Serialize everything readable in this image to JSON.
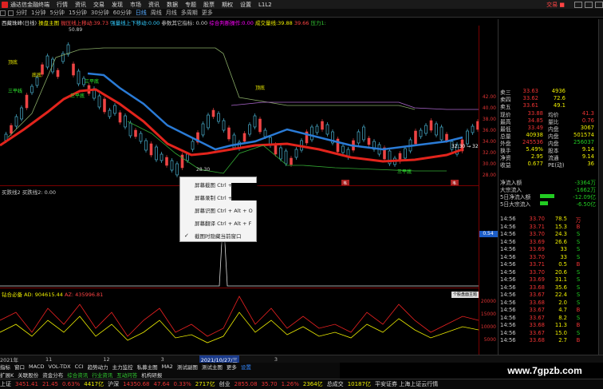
{
  "menubar": {
    "app_title": "通达信金融终端",
    "items": [
      "行情",
      "资讯",
      "交易",
      "发现",
      "市场",
      "资讯",
      "数据",
      "专题",
      "股票",
      "期权",
      "设置"
    ],
    "user": "L1L2",
    "trade_label": "交易 ■"
  },
  "toolbar": {
    "items": [
      "分时",
      "1分钟",
      "5分钟",
      "15分钟",
      "30分钟",
      "60分钟",
      "日线",
      "周线",
      "月线",
      "多周期",
      "更多"
    ],
    "active_index": 6
  },
  "chart_header": {
    "stock": "西藏珠峰(日线)",
    "indicator": "操盘主图",
    "p1": "抛压线上移动:39.73",
    "p2": "强量线上下移动:0.00",
    "p3": "参数其它指标: 0.00",
    "p4": "综合判断操作:0.00",
    "p5": "成交量线:39.88",
    "p6": "39.66",
    "p7": "压力1:"
  },
  "main_chart": {
    "high_label": "50.89",
    "low_label": "28.30",
    "annotations": [
      "顶底",
      "三平线",
      "底底",
      "三平底",
      "三平底",
      "三平底",
      "顶底"
    ],
    "axis_ticks": [
      "42.00",
      "40.00",
      "38.00",
      "36.00",
      "34.00",
      "32.00",
      "30.00",
      "28.00"
    ],
    "price_tag": "32.30 → 32",
    "mark_left": "韦",
    "mark_right": "韦"
  },
  "vol_panel": {
    "label": "买跌线2  买跌线2: 0.00",
    "axis_value": "0.54"
  },
  "ind_panel": {
    "label": "钻合必备 AD: 904615.44",
    "label2": "AZ: 435996.81",
    "axis_ticks": [
      "20000",
      "15000",
      "10000",
      "5000"
    ],
    "inset_label": "个股盘面主题"
  },
  "context_menu": {
    "items": [
      {
        "label": "屏幕截图  Ctrl + Alt + A"
      },
      {
        "label": "屏幕录制  Ctrl + Alt + R"
      },
      {
        "label": "屏幕识图  Ctrl + Alt + O"
      },
      {
        "label": "屏幕翻译  Ctrl + Alt + F"
      },
      {
        "label": "截图时隐藏当前窗口",
        "checked": true
      }
    ],
    "checkmark": "✓"
  },
  "quote": {
    "asks": [
      {
        "label": "卖三",
        "price": "33.63",
        "vol": "4936"
      },
      {
        "label": "卖四",
        "price": "33.62",
        "vol": "72.6"
      },
      {
        "label": "卖五",
        "price": "33.61",
        "vol": "49.1"
      }
    ],
    "stats": [
      {
        "l1": "现价",
        "v1": "33.88",
        "l2": "均价",
        "v2": "41.3"
      },
      {
        "l1": "最高",
        "v1": "34.85",
        "l2": "量比",
        "v2": "0.76"
      },
      {
        "l1": "最低",
        "v1": "33.49",
        "l2": "内盘",
        "v2": "3067"
      },
      {
        "l1": "总量",
        "v1": "40938",
        "l2": "内盘",
        "v2": "501574"
      },
      {
        "l1": "外盘",
        "v1": "245536",
        "l2": "内盘",
        "v2": "256037"
      },
      {
        "l1": "换手",
        "v1": "5.49%",
        "l2": "股本",
        "v2": "9.14"
      },
      {
        "l1": "净资",
        "v1": "2.95",
        "l2": "流通",
        "v2": "9.14"
      },
      {
        "l1": "收益",
        "v1": "0.677",
        "l2": "PE(动)",
        "v2": "36"
      }
    ],
    "flows": [
      {
        "label": "净流入额",
        "value": "-3364万",
        "color": "#2c2"
      },
      {
        "label": "大宗流入",
        "value": "-1662万",
        "color": "#2c2"
      },
      {
        "label": "5日净流入额",
        "value": "-12.09亿",
        "color": "#2c2"
      },
      {
        "label": "5日大宗流入",
        "value": "-6.50亿",
        "color": "#2c2"
      }
    ],
    "ticks": [
      {
        "t": "14:56",
        "p": "33.70",
        "v": "78.5",
        "d": "万"
      },
      {
        "t": "14:56",
        "p": "33.71",
        "v": "15.3",
        "d": "B"
      },
      {
        "t": "14:56",
        "p": "33.70",
        "v": "24.3",
        "d": "S"
      },
      {
        "t": "14:56",
        "p": "33.69",
        "v": "26.6",
        "d": "S"
      },
      {
        "t": "14:56",
        "p": "33.69",
        "v": "33",
        "d": "S"
      },
      {
        "t": "14:56",
        "p": "33.70",
        "v": "33",
        "d": "S"
      },
      {
        "t": "14:56",
        "p": "33.71",
        "v": "0.5",
        "d": "B"
      },
      {
        "t": "14:56",
        "p": "33.70",
        "v": "20.6",
        "d": "S"
      },
      {
        "t": "14:56",
        "p": "33.69",
        "v": "31.1",
        "d": "S"
      },
      {
        "t": "14:56",
        "p": "33.68",
        "v": "35.6",
        "d": "S"
      },
      {
        "t": "14:56",
        "p": "33.67",
        "v": "22.4",
        "d": "S"
      },
      {
        "t": "14:56",
        "p": "33.68",
        "v": "2.0",
        "d": "S"
      },
      {
        "t": "14:56",
        "p": "33.67",
        "v": "4.7",
        "d": "B"
      },
      {
        "t": "14:56",
        "p": "33.67",
        "v": "8.2",
        "d": "S"
      },
      {
        "t": "14:56",
        "p": "33.68",
        "v": "11.3",
        "d": "B"
      },
      {
        "t": "14:56",
        "p": "33.67",
        "v": "15.0",
        "d": "S"
      },
      {
        "t": "14:56",
        "p": "33.68",
        "v": "2.7",
        "d": "B"
      }
    ]
  },
  "tabbar": {
    "left_label": "2021年",
    "items": [
      "11",
      "",
      "12",
      "",
      "3",
      "",
      "2021/10/27/三",
      "",
      "3",
      "",
      "",
      "",
      "11",
      "12",
      "2",
      "3"
    ],
    "date_index": 6
  },
  "subtabs": {
    "items": [
      "指标",
      "窗口",
      "MACD",
      "VOL-TDX",
      "CCI",
      "趋势动力",
      "主力监控",
      "私募主图",
      "MA2",
      "测试副图",
      "测试主图",
      "更多",
      "设置"
    ],
    "second": [
      "扩展K",
      "关联股份",
      "资金分布",
      "综合资讯",
      "行业资讯",
      "互动问答",
      "机构研报"
    ]
  },
  "watermark": "www.7gpzb.com",
  "status": {
    "sh_label": "上证",
    "sh_value": "3451.41",
    "sh_change": "21.45",
    "sh_pct": "0.63%",
    "sh_vol": "4417亿",
    "sz_label": "沪深",
    "sz_value": "14350.68",
    "sz_change": "47.64",
    "sz_pct": "0.33%",
    "sz_vol": "2717亿",
    "cy_label": "创业",
    "cy_value": "2855.08",
    "cy_change": "35.70",
    "cy_pct": "1.26%",
    "cy_vol": "2364亿",
    "misc": "总成交",
    "misc_value": "10187亿",
    "tail": "平安证券 上海上证云行情"
  }
}
